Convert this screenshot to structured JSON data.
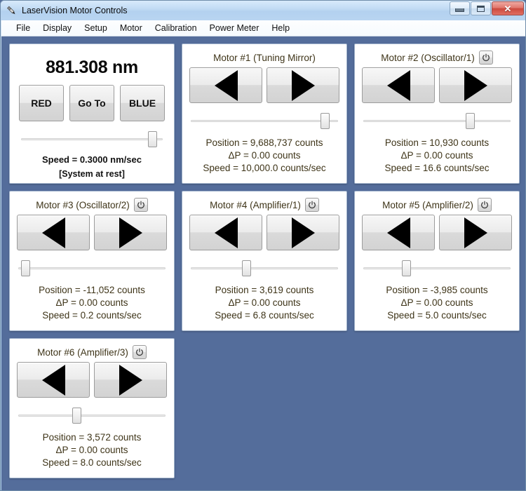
{
  "window": {
    "title": "LaserVision Motor Controls",
    "icon": "pen-tool-icon",
    "buttons": {
      "minimize": "minimize-icon",
      "maximize": "maximize-icon",
      "close": "✕"
    }
  },
  "menubar": {
    "items": [
      "File",
      "Display",
      "Setup",
      "Motor",
      "Calibration",
      "Power Meter",
      "Help"
    ]
  },
  "laser_panel": {
    "wavelength": "881.308 nm",
    "buttons": [
      "RED",
      "Go To",
      "BLUE"
    ],
    "slider_percent": 96,
    "speed": "Speed = 0.3000 nm/sec",
    "status": "[System at rest]"
  },
  "motors": [
    {
      "title": "Motor #1 (Tuning Mirror)",
      "has_power_button": false,
      "left_arrow": "left-arrow-icon",
      "right_arrow": "right-arrow-icon",
      "slider_percent": 94,
      "position": "Position = 9,688,737 counts",
      "delta": "ΔP = 0.00 counts",
      "speed": "Speed = 10,000.0 counts/sec"
    },
    {
      "title": "Motor #2 (Oscillator/1)",
      "has_power_button": true,
      "power_icon": "power-icon",
      "left_arrow": "left-arrow-icon",
      "right_arrow": "right-arrow-icon",
      "slider_percent": 74,
      "position": "Position = 10,930 counts",
      "delta": "ΔP = 0.00 counts",
      "speed": "Speed = 16.6 counts/sec"
    },
    {
      "title": "Motor #3 (Oscillator/2)",
      "has_power_button": true,
      "power_icon": "power-icon",
      "left_arrow": "left-arrow-icon",
      "right_arrow": "right-arrow-icon",
      "slider_percent": 2,
      "position": "Position = -11,052 counts",
      "delta": "ΔP = 0.00 counts",
      "speed": "Speed = 0.2 counts/sec"
    },
    {
      "title": "Motor #4 (Amplifier/1)",
      "has_power_button": true,
      "power_icon": "power-icon",
      "left_arrow": "left-arrow-icon",
      "right_arrow": "right-arrow-icon",
      "slider_percent": 37,
      "position": "Position = 3,619 counts",
      "delta": "ΔP = 0.00 counts",
      "speed": "Speed = 6.8 counts/sec"
    },
    {
      "title": "Motor #5 (Amplifier/2)",
      "has_power_button": true,
      "power_icon": "power-icon",
      "left_arrow": "left-arrow-icon",
      "right_arrow": "right-arrow-icon",
      "slider_percent": 28,
      "position": "Position = -3,985 counts",
      "delta": "ΔP = 0.00 counts",
      "speed": "Speed = 5.0 counts/sec"
    },
    {
      "title": "Motor #6 (Amplifier/3)",
      "has_power_button": true,
      "power_icon": "power-icon",
      "left_arrow": "left-arrow-icon",
      "right_arrow": "right-arrow-icon",
      "slider_percent": 39,
      "position": "Position = 3,572 counts",
      "delta": "ΔP = 0.00 counts",
      "speed": "Speed = 8.0 counts/sec"
    }
  ],
  "colors": {
    "client_background": "#546d9b",
    "panel_background": "#ffffff",
    "readout_text": "#3e3418",
    "titlebar": "#b9d5f1",
    "close_button": "#cc4a3e"
  }
}
